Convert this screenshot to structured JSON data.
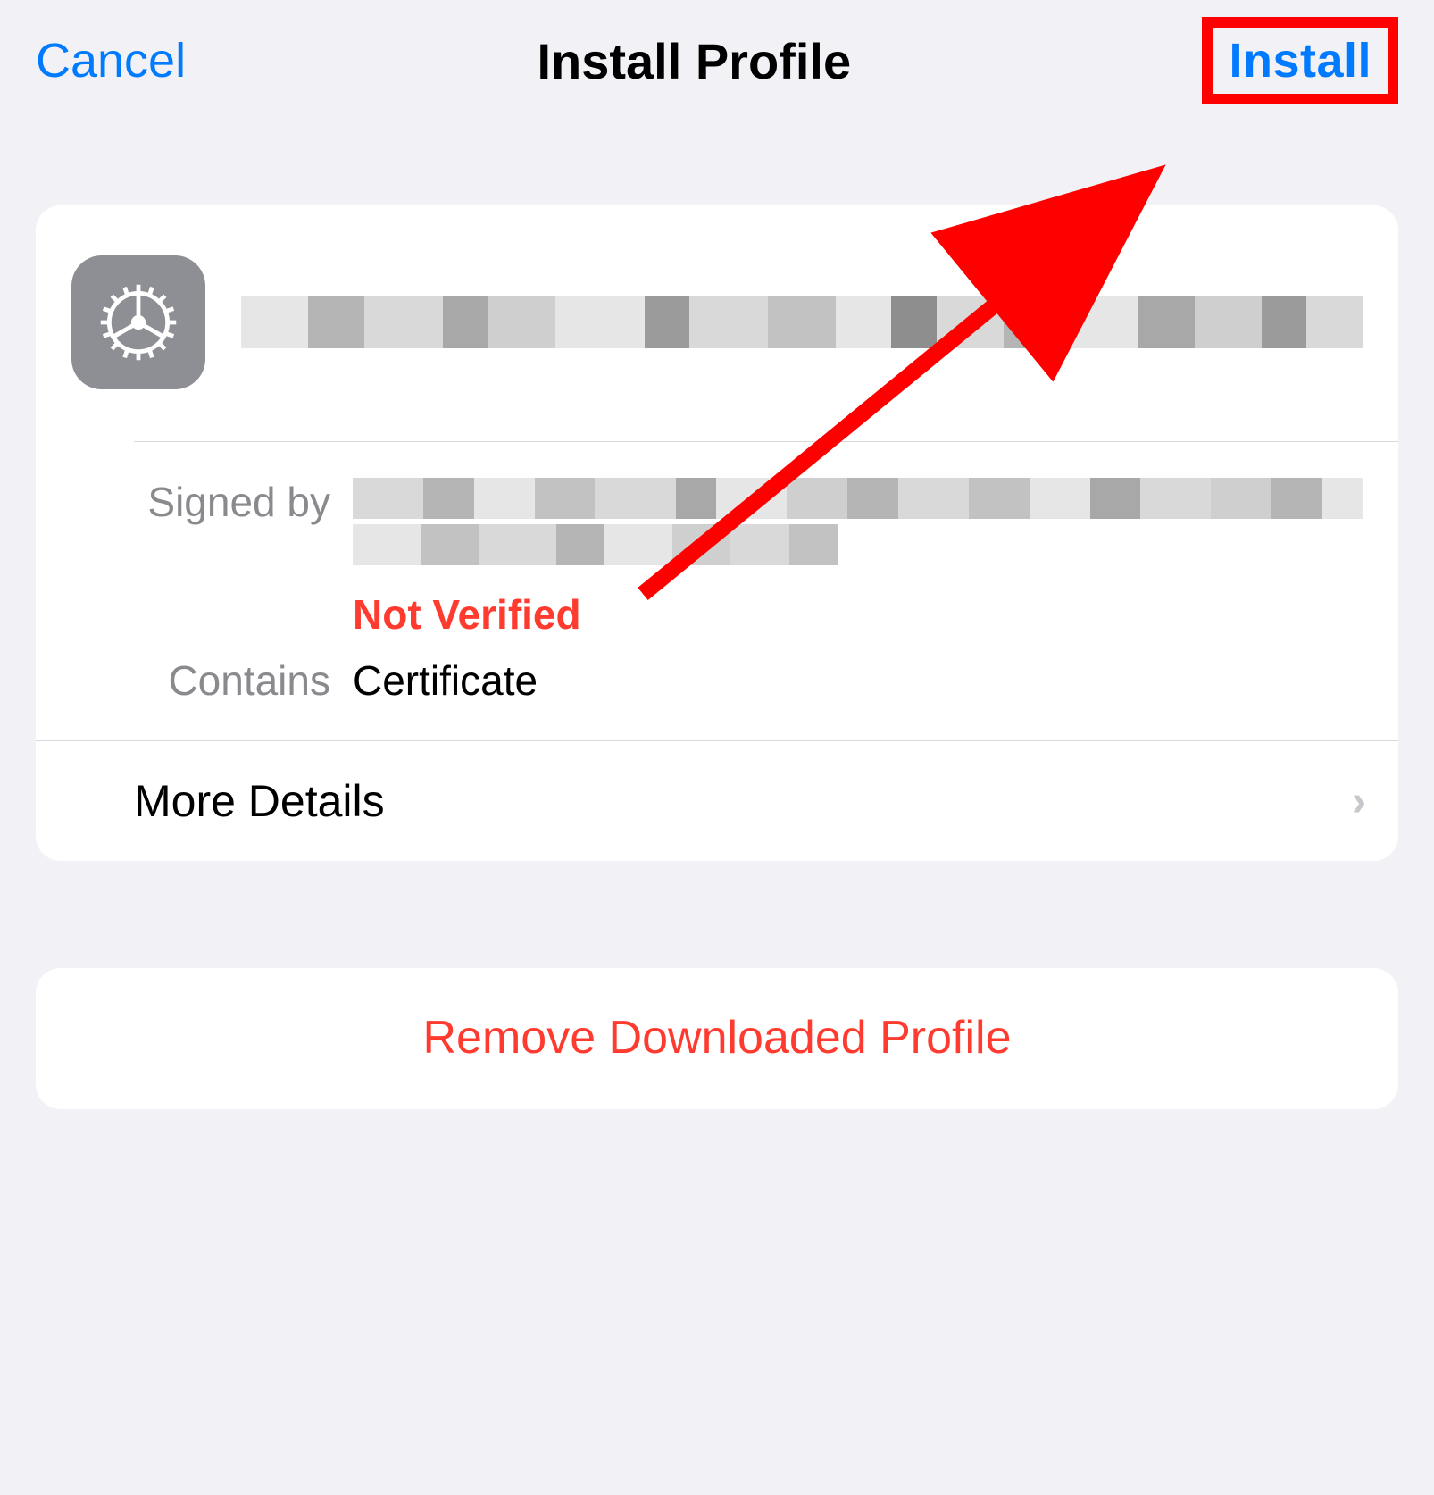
{
  "header": {
    "cancel": "Cancel",
    "title": "Install Profile",
    "install": "Install"
  },
  "profile": {
    "signed_by_label": "Signed by",
    "not_verified": "Not Verified",
    "contains_label": "Contains",
    "contains_value": "Certificate",
    "more_details": "More Details"
  },
  "remove_button": "Remove Downloaded Profile",
  "colors": {
    "accent": "#007aff",
    "destructive": "#ff3b30",
    "annotation": "#ff0000"
  }
}
